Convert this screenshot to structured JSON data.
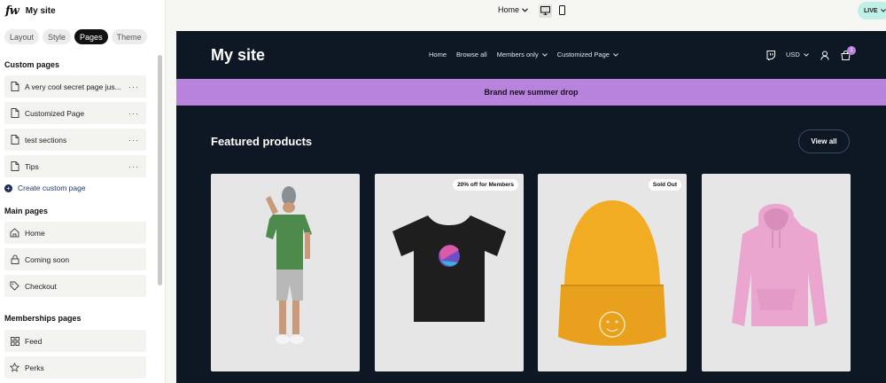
{
  "editor": {
    "logo": "fw",
    "site_name": "My site",
    "tabs": [
      "Layout",
      "Style",
      "Pages",
      "Theme"
    ],
    "active_tab": "Pages",
    "sections": {
      "custom": {
        "title": "Custom pages",
        "items": [
          "A very cool secret page jus...",
          "Customized Page",
          "test sections",
          "Tips"
        ],
        "create_label": "Create custom page"
      },
      "main": {
        "title": "Main pages",
        "items": [
          "Home",
          "Coming soon",
          "Checkout"
        ]
      },
      "memberships": {
        "title": "Memberships pages",
        "items": [
          "Feed",
          "Perks"
        ]
      }
    },
    "more_glyph": "···"
  },
  "toolbar": {
    "page_select": "Home",
    "status": "LIVE"
  },
  "site": {
    "title": "My site",
    "nav": [
      "Home",
      "Browse all",
      "Members only",
      "Customized Page"
    ],
    "currency": "USD",
    "cart_count": "1",
    "banner": "Brand new summer drop",
    "section_title": "Featured products",
    "view_all": "View all",
    "products": [
      {
        "badge": ""
      },
      {
        "badge": "20% off for Members"
      },
      {
        "badge": "Sold Out"
      },
      {
        "badge": ""
      }
    ]
  },
  "colors": {
    "accent": "#b783dc",
    "preview_bg": "#0e1825",
    "live_bg": "#bff0e6",
    "beanie": "#f2ac24",
    "hoodie": "#eba6cf",
    "shirt_green": "#4e8a4c"
  },
  "icons": {
    "page": "page-icon",
    "home": "home-icon",
    "lock": "lock-icon",
    "tag": "tag-icon",
    "grid": "grid-icon",
    "star": "star-icon",
    "desktop": "desktop-icon",
    "mobile": "mobile-icon",
    "twitch": "twitch-icon",
    "user": "user-icon",
    "cart": "cart-icon"
  }
}
